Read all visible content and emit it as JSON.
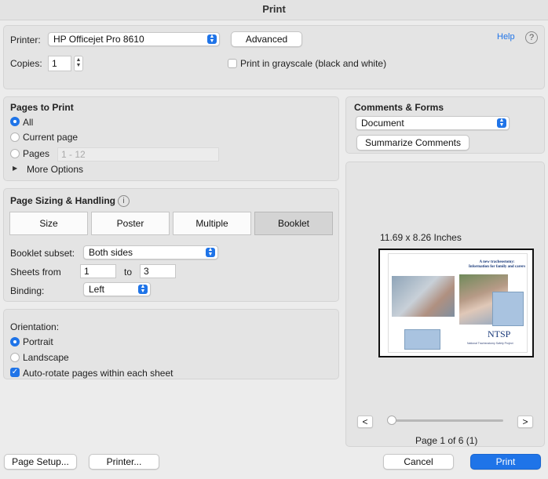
{
  "window": {
    "title": "Print"
  },
  "printer": {
    "label": "Printer:",
    "value": "HP Officejet Pro 8610",
    "advanced_label": "Advanced",
    "help_label": "Help",
    "help_symbol": "?"
  },
  "copies": {
    "label": "Copies:",
    "value": "1"
  },
  "grayscale": {
    "label": "Print in grayscale (black and white)",
    "checked": false
  },
  "pages_to_print": {
    "title": "Pages to Print",
    "all_label": "All",
    "current_label": "Current page",
    "pages_label": "Pages",
    "pages_placeholder": "1 - 12",
    "more_options_label": "More Options"
  },
  "sizing": {
    "title": "Page Sizing & Handling",
    "info_symbol": "i",
    "tabs": [
      "Size",
      "Poster",
      "Multiple",
      "Booklet"
    ],
    "selected_tab": "Booklet",
    "subset_label": "Booklet subset:",
    "subset_value": "Both sides",
    "sheets_label": "Sheets from",
    "sheets_from": "1",
    "sheets_to_label": "to",
    "sheets_to": "3",
    "binding_label": "Binding:",
    "binding_value": "Left"
  },
  "orientation": {
    "title": "Orientation:",
    "portrait_label": "Portrait",
    "landscape_label": "Landscape",
    "autorotate_label": "Auto-rotate pages within each sheet"
  },
  "comments": {
    "title": "Comments & Forms",
    "value": "Document",
    "summarize_label": "Summarize Comments"
  },
  "preview": {
    "dimensions": "11.69 x 8.26 Inches",
    "page_heading_line1": "A new tracheostomy:",
    "page_heading_line2": "Information for family and carers",
    "logo_text": "NTSP",
    "logo_sub": "National Tracheostomy Safety Project",
    "prev_symbol": "<",
    "next_symbol": ">",
    "page_indicator": "Page 1 of 6 (1)",
    "slider_position": 0
  },
  "footer": {
    "page_setup_label": "Page Setup...",
    "printer_label": "Printer...",
    "cancel_label": "Cancel",
    "print_label": "Print"
  },
  "colors": {
    "accent": "#1f74e8"
  }
}
